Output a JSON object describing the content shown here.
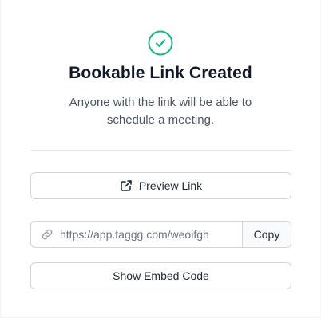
{
  "dialog": {
    "title": "Bookable Link Created",
    "description": "Anyone with the link will be able to schedule a meeting.",
    "success_icon": "check-circle-icon",
    "accent_color": "#10b981"
  },
  "actions": {
    "preview_label": "Preview Link",
    "preview_icon": "external-link-icon",
    "link_value": "https://app.taggg.com/weoifgh",
    "link_icon": "link-icon",
    "copy_label": "Copy",
    "embed_label": "Show Embed Code"
  }
}
